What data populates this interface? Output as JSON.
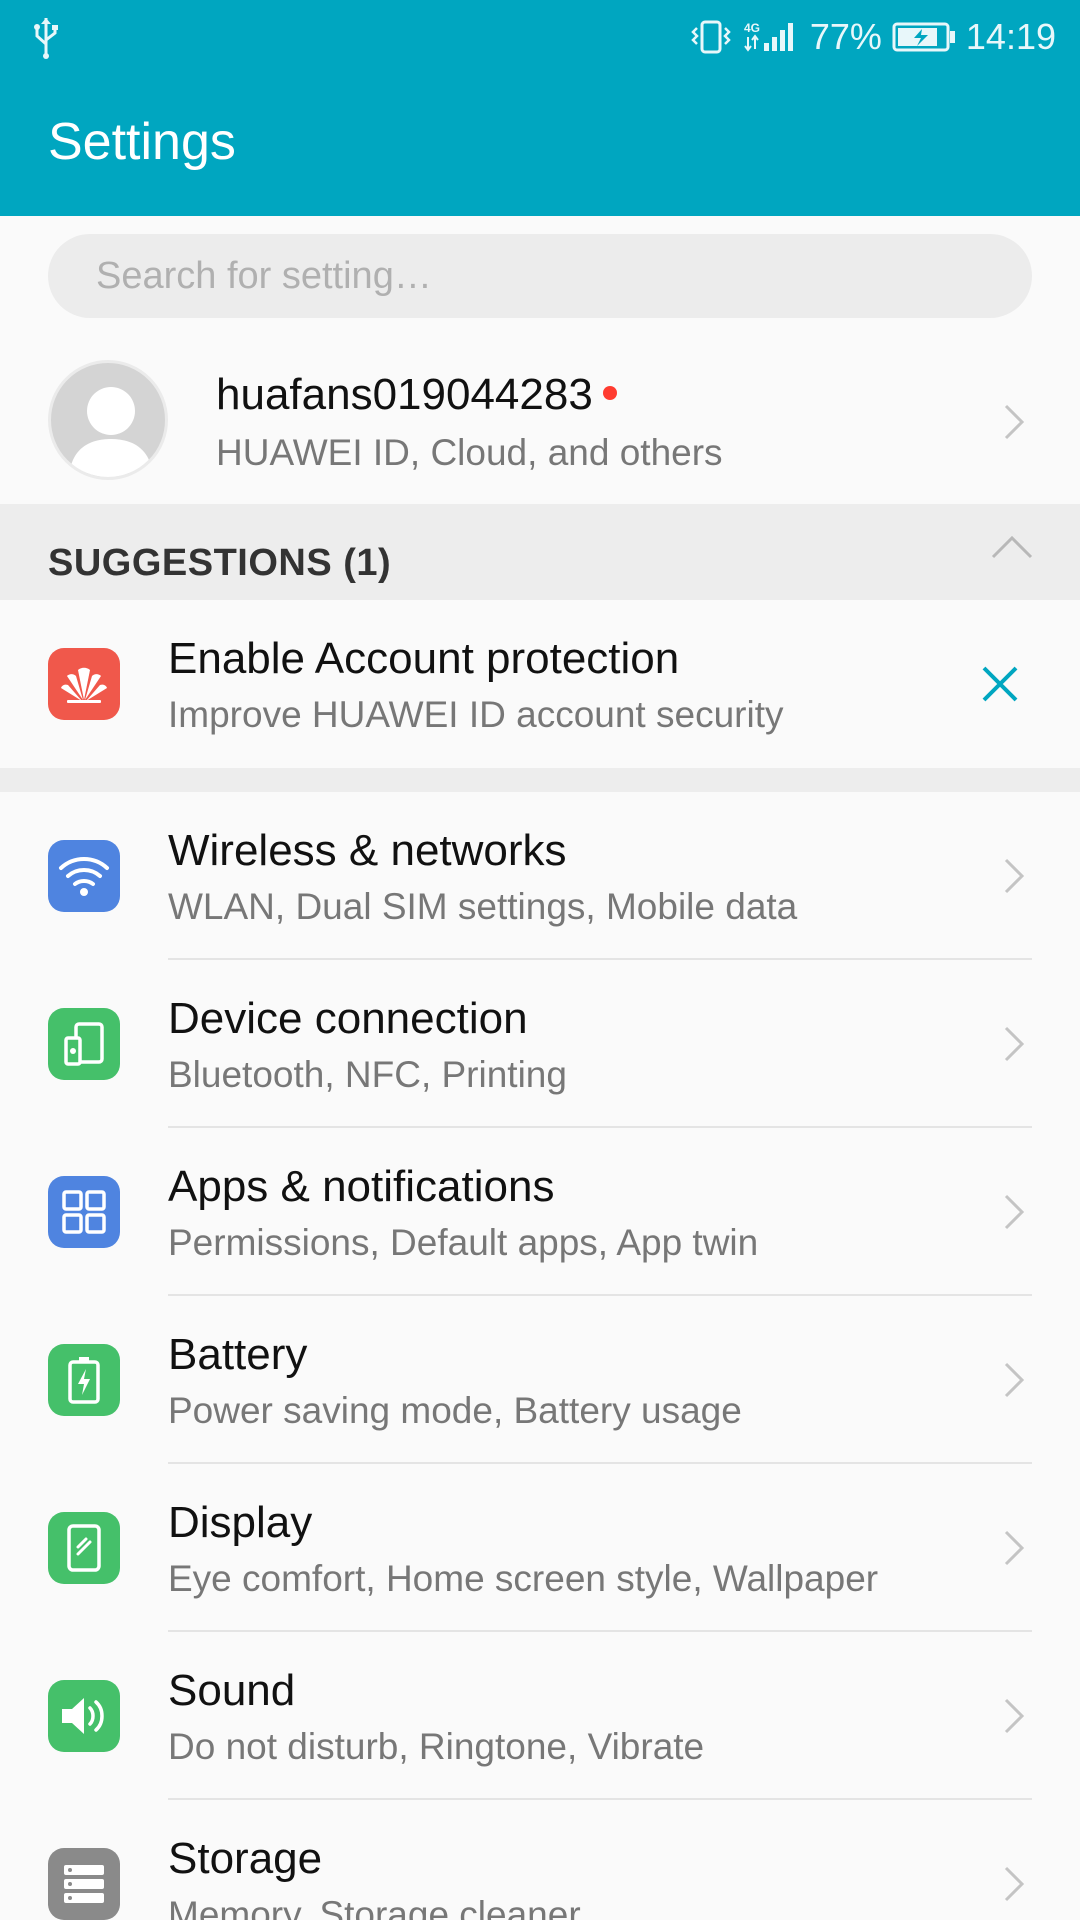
{
  "status_bar": {
    "battery_percent": "77%",
    "time": "14:19",
    "icons": [
      "usb-icon",
      "vibrate-icon",
      "signal-4g-icon",
      "battery-charging-icon"
    ]
  },
  "header": {
    "title": "Settings"
  },
  "search": {
    "placeholder": "Search for setting…",
    "value": ""
  },
  "account": {
    "name": "huafans019044283",
    "subtitle": "HUAWEI ID, Cloud, and others",
    "has_notification_dot": true
  },
  "suggestions": {
    "header": "SUGGESTIONS (1)",
    "items": [
      {
        "title": "Enable Account protection",
        "subtitle": "Improve HUAWEI ID account security",
        "icon": "huawei-logo-icon",
        "color": "#f0584b"
      }
    ]
  },
  "settings": [
    {
      "title": "Wireless & networks",
      "subtitle": "WLAN, Dual SIM settings, Mobile data",
      "icon": "wifi-icon",
      "color": "#4f84e0"
    },
    {
      "title": "Device connection",
      "subtitle": "Bluetooth, NFC, Printing",
      "icon": "device-connection-icon",
      "color": "#45c06a"
    },
    {
      "title": "Apps & notifications",
      "subtitle": "Permissions, Default apps, App twin",
      "icon": "apps-grid-icon",
      "color": "#4f84e0"
    },
    {
      "title": "Battery",
      "subtitle": "Power saving mode, Battery usage",
      "icon": "battery-icon",
      "color": "#45c06a"
    },
    {
      "title": "Display",
      "subtitle": "Eye comfort, Home screen style, Wallpaper",
      "icon": "display-icon",
      "color": "#45c06a"
    },
    {
      "title": "Sound",
      "subtitle": "Do not disturb, Ringtone, Vibrate",
      "icon": "sound-icon",
      "color": "#45c06a"
    },
    {
      "title": "Storage",
      "subtitle": "Memory, Storage cleaner",
      "icon": "storage-icon",
      "color": "#8a8a8a"
    }
  ],
  "colors": {
    "accent": "#00a6c0",
    "background": "#fafafa",
    "section_band": "#ededed",
    "notification_dot": "#ff3b30"
  }
}
